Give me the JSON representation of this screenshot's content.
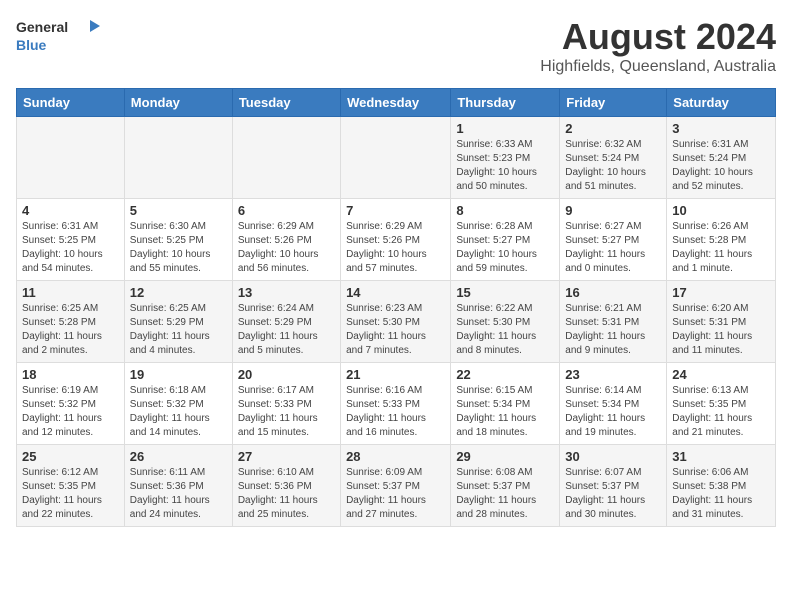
{
  "header": {
    "logo_general": "General",
    "logo_blue": "Blue",
    "main_title": "August 2024",
    "subtitle": "Highfields, Queensland, Australia"
  },
  "weekdays": [
    "Sunday",
    "Monday",
    "Tuesday",
    "Wednesday",
    "Thursday",
    "Friday",
    "Saturday"
  ],
  "weeks": [
    [
      {
        "day": "",
        "sunrise": "",
        "sunset": "",
        "daylight": ""
      },
      {
        "day": "",
        "sunrise": "",
        "sunset": "",
        "daylight": ""
      },
      {
        "day": "",
        "sunrise": "",
        "sunset": "",
        "daylight": ""
      },
      {
        "day": "",
        "sunrise": "",
        "sunset": "",
        "daylight": ""
      },
      {
        "day": "1",
        "sunrise": "Sunrise: 6:33 AM",
        "sunset": "Sunset: 5:23 PM",
        "daylight": "Daylight: 10 hours and 50 minutes."
      },
      {
        "day": "2",
        "sunrise": "Sunrise: 6:32 AM",
        "sunset": "Sunset: 5:24 PM",
        "daylight": "Daylight: 10 hours and 51 minutes."
      },
      {
        "day": "3",
        "sunrise": "Sunrise: 6:31 AM",
        "sunset": "Sunset: 5:24 PM",
        "daylight": "Daylight: 10 hours and 52 minutes."
      }
    ],
    [
      {
        "day": "4",
        "sunrise": "Sunrise: 6:31 AM",
        "sunset": "Sunset: 5:25 PM",
        "daylight": "Daylight: 10 hours and 54 minutes."
      },
      {
        "day": "5",
        "sunrise": "Sunrise: 6:30 AM",
        "sunset": "Sunset: 5:25 PM",
        "daylight": "Daylight: 10 hours and 55 minutes."
      },
      {
        "day": "6",
        "sunrise": "Sunrise: 6:29 AM",
        "sunset": "Sunset: 5:26 PM",
        "daylight": "Daylight: 10 hours and 56 minutes."
      },
      {
        "day": "7",
        "sunrise": "Sunrise: 6:29 AM",
        "sunset": "Sunset: 5:26 PM",
        "daylight": "Daylight: 10 hours and 57 minutes."
      },
      {
        "day": "8",
        "sunrise": "Sunrise: 6:28 AM",
        "sunset": "Sunset: 5:27 PM",
        "daylight": "Daylight: 10 hours and 59 minutes."
      },
      {
        "day": "9",
        "sunrise": "Sunrise: 6:27 AM",
        "sunset": "Sunset: 5:27 PM",
        "daylight": "Daylight: 11 hours and 0 minutes."
      },
      {
        "day": "10",
        "sunrise": "Sunrise: 6:26 AM",
        "sunset": "Sunset: 5:28 PM",
        "daylight": "Daylight: 11 hours and 1 minute."
      }
    ],
    [
      {
        "day": "11",
        "sunrise": "Sunrise: 6:25 AM",
        "sunset": "Sunset: 5:28 PM",
        "daylight": "Daylight: 11 hours and 2 minutes."
      },
      {
        "day": "12",
        "sunrise": "Sunrise: 6:25 AM",
        "sunset": "Sunset: 5:29 PM",
        "daylight": "Daylight: 11 hours and 4 minutes."
      },
      {
        "day": "13",
        "sunrise": "Sunrise: 6:24 AM",
        "sunset": "Sunset: 5:29 PM",
        "daylight": "Daylight: 11 hours and 5 minutes."
      },
      {
        "day": "14",
        "sunrise": "Sunrise: 6:23 AM",
        "sunset": "Sunset: 5:30 PM",
        "daylight": "Daylight: 11 hours and 7 minutes."
      },
      {
        "day": "15",
        "sunrise": "Sunrise: 6:22 AM",
        "sunset": "Sunset: 5:30 PM",
        "daylight": "Daylight: 11 hours and 8 minutes."
      },
      {
        "day": "16",
        "sunrise": "Sunrise: 6:21 AM",
        "sunset": "Sunset: 5:31 PM",
        "daylight": "Daylight: 11 hours and 9 minutes."
      },
      {
        "day": "17",
        "sunrise": "Sunrise: 6:20 AM",
        "sunset": "Sunset: 5:31 PM",
        "daylight": "Daylight: 11 hours and 11 minutes."
      }
    ],
    [
      {
        "day": "18",
        "sunrise": "Sunrise: 6:19 AM",
        "sunset": "Sunset: 5:32 PM",
        "daylight": "Daylight: 11 hours and 12 minutes."
      },
      {
        "day": "19",
        "sunrise": "Sunrise: 6:18 AM",
        "sunset": "Sunset: 5:32 PM",
        "daylight": "Daylight: 11 hours and 14 minutes."
      },
      {
        "day": "20",
        "sunrise": "Sunrise: 6:17 AM",
        "sunset": "Sunset: 5:33 PM",
        "daylight": "Daylight: 11 hours and 15 minutes."
      },
      {
        "day": "21",
        "sunrise": "Sunrise: 6:16 AM",
        "sunset": "Sunset: 5:33 PM",
        "daylight": "Daylight: 11 hours and 16 minutes."
      },
      {
        "day": "22",
        "sunrise": "Sunrise: 6:15 AM",
        "sunset": "Sunset: 5:34 PM",
        "daylight": "Daylight: 11 hours and 18 minutes."
      },
      {
        "day": "23",
        "sunrise": "Sunrise: 6:14 AM",
        "sunset": "Sunset: 5:34 PM",
        "daylight": "Daylight: 11 hours and 19 minutes."
      },
      {
        "day": "24",
        "sunrise": "Sunrise: 6:13 AM",
        "sunset": "Sunset: 5:35 PM",
        "daylight": "Daylight: 11 hours and 21 minutes."
      }
    ],
    [
      {
        "day": "25",
        "sunrise": "Sunrise: 6:12 AM",
        "sunset": "Sunset: 5:35 PM",
        "daylight": "Daylight: 11 hours and 22 minutes."
      },
      {
        "day": "26",
        "sunrise": "Sunrise: 6:11 AM",
        "sunset": "Sunset: 5:36 PM",
        "daylight": "Daylight: 11 hours and 24 minutes."
      },
      {
        "day": "27",
        "sunrise": "Sunrise: 6:10 AM",
        "sunset": "Sunset: 5:36 PM",
        "daylight": "Daylight: 11 hours and 25 minutes."
      },
      {
        "day": "28",
        "sunrise": "Sunrise: 6:09 AM",
        "sunset": "Sunset: 5:37 PM",
        "daylight": "Daylight: 11 hours and 27 minutes."
      },
      {
        "day": "29",
        "sunrise": "Sunrise: 6:08 AM",
        "sunset": "Sunset: 5:37 PM",
        "daylight": "Daylight: 11 hours and 28 minutes."
      },
      {
        "day": "30",
        "sunrise": "Sunrise: 6:07 AM",
        "sunset": "Sunset: 5:37 PM",
        "daylight": "Daylight: 11 hours and 30 minutes."
      },
      {
        "day": "31",
        "sunrise": "Sunrise: 6:06 AM",
        "sunset": "Sunset: 5:38 PM",
        "daylight": "Daylight: 11 hours and 31 minutes."
      }
    ]
  ]
}
